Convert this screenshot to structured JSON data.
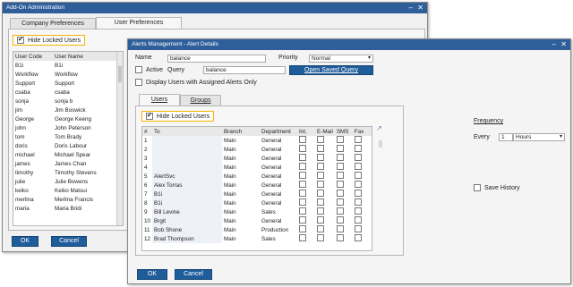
{
  "addon": {
    "title": "Add-On Administration",
    "tabs": [
      "Company Preferences",
      "User Preferences"
    ],
    "hide_locked": "Hide Locked Users",
    "columns": [
      "User Code",
      "User Name"
    ],
    "rows": [
      [
        "B1i",
        "B1i"
      ],
      [
        "Workflow",
        "Workflow"
      ],
      [
        "Support",
        "Support"
      ],
      [
        "csaba",
        "csaba"
      ],
      [
        "sonja",
        "sonja b"
      ],
      [
        "jim",
        "Jim Boswick"
      ],
      [
        "George",
        "George Keeng"
      ],
      [
        "john",
        "John Peterson"
      ],
      [
        "tom",
        "Tom Brady"
      ],
      [
        "doris",
        "Doris Labour"
      ],
      [
        "michael",
        "Michael Spear"
      ],
      [
        "james",
        "James Chan"
      ],
      [
        "timothy",
        "Timothy Stevens"
      ],
      [
        "julie",
        "Julie Bowens"
      ],
      [
        "keiko",
        "Keiko Matsui"
      ],
      [
        "merlina",
        "Merlina Francis"
      ],
      [
        "maria",
        "Maria Bridi"
      ]
    ],
    "ok": "OK",
    "cancel": "Cancel"
  },
  "alert": {
    "title": "Alerts Management - Alert Details",
    "name_label": "Name",
    "name_value": "balance",
    "priority_label": "Priority",
    "priority_value": "Normal",
    "active_label": "Active",
    "query_label": "Query",
    "query_value": "balance",
    "open_saved_query": "Open Saved Query",
    "display_users": "Display Users with Assigned Alerts Only",
    "tabs": [
      "Users",
      "Groups"
    ],
    "hide_locked": "Hide Locked Users",
    "columns": [
      "#",
      "To",
      "Branch",
      "Department",
      "Int.",
      "E-Mail",
      "SMS",
      "Fax"
    ],
    "rows": [
      [
        "1",
        "",
        "Main",
        "General"
      ],
      [
        "2",
        "",
        "Main",
        "General"
      ],
      [
        "3",
        "",
        "Main",
        "General"
      ],
      [
        "4",
        "",
        "Main",
        "General"
      ],
      [
        "5",
        "AlertSvc",
        "Main",
        "General"
      ],
      [
        "6",
        "Alex Torras",
        "Main",
        "General"
      ],
      [
        "7",
        "B1i",
        "Main",
        "General"
      ],
      [
        "8",
        "B1i",
        "Main",
        "General"
      ],
      [
        "9",
        "Bill Levine",
        "Main",
        "Sales"
      ],
      [
        "10",
        "Brgit",
        "Main",
        "General"
      ],
      [
        "11",
        "Bob Shone",
        "Main",
        "Production"
      ],
      [
        "12",
        "Brad Thompson",
        "Main",
        "Sales"
      ]
    ],
    "frequency_label": "Frequency",
    "every_label": "Every",
    "every_value": "1",
    "unit_value": "Hours",
    "save_history": "Save History",
    "ok": "OK",
    "cancel": "Cancel"
  }
}
